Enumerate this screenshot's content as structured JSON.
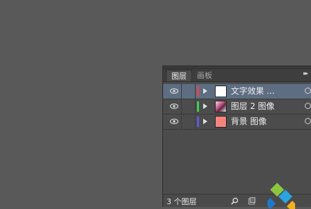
{
  "panel": {
    "tabs": [
      {
        "label": "图层",
        "active": true
      },
      {
        "label": "画板",
        "active": false
      }
    ],
    "menu_glyph": "▸▸"
  },
  "layers": [
    {
      "name": "文字效果 ...",
      "color": "#e0464e",
      "thumb": "white",
      "selected": true
    },
    {
      "name": "图层 2 图像",
      "color": "#3fd24a",
      "thumb": "image",
      "selected": false
    },
    {
      "name": "背景 图像",
      "color": "#5a5ad8",
      "thumb": "salmon",
      "selected": false
    }
  ],
  "status": {
    "layer_count": "3 个图层"
  },
  "colors": {
    "background": "#595959",
    "panel": "#4c4c4c",
    "selected_row": "#5e6e82"
  },
  "icons": [
    "eye-icon",
    "expand-arrow-icon",
    "search-icon",
    "new-layer-icon",
    "watermark-logo-icon"
  ]
}
